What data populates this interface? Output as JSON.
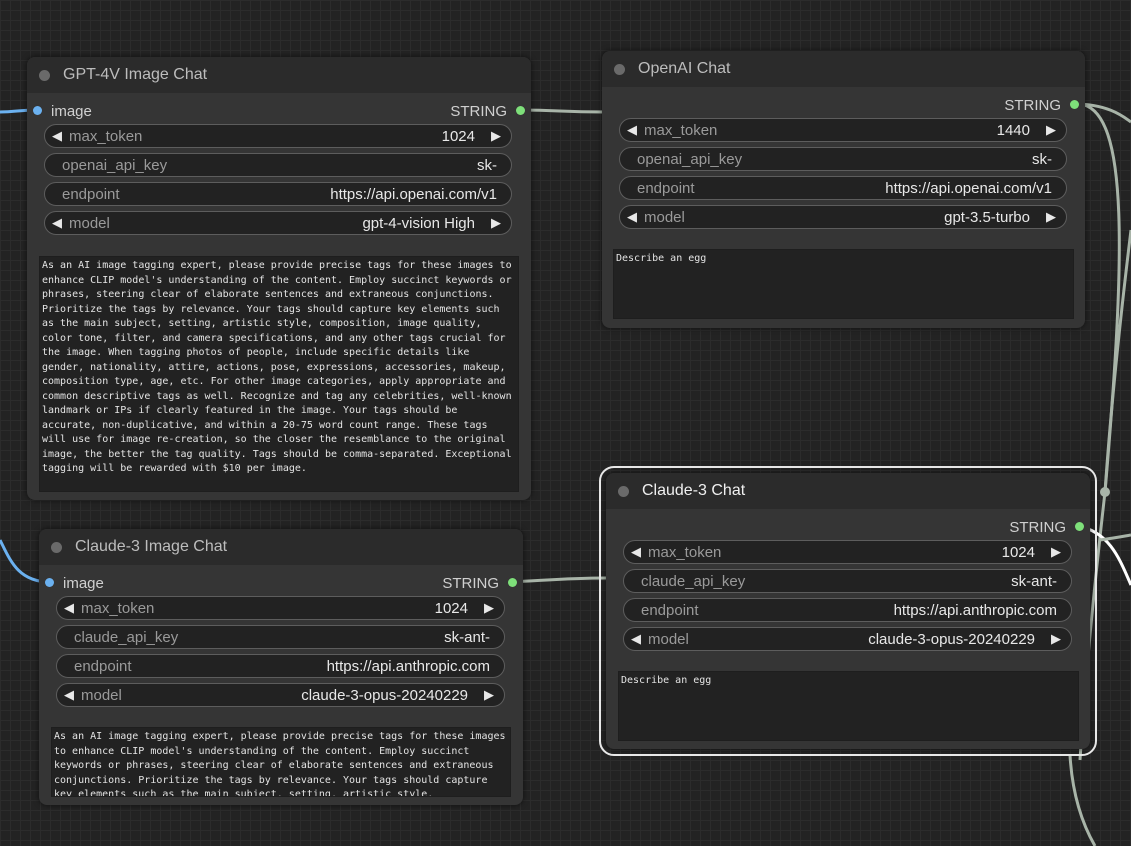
{
  "nodes": {
    "gpt4v": {
      "title": "GPT-4V Image Chat",
      "input_label": "image",
      "output_label": "STRING",
      "max_token_label": "max_token",
      "max_token_value": "1024",
      "api_key_label": "openai_api_key",
      "api_key_value": "sk-",
      "endpoint_label": "endpoint",
      "endpoint_value": "https://api.openai.com/v1",
      "model_label": "model",
      "model_value": "gpt-4-vision High",
      "prompt": "As an AI image tagging expert, please provide precise tags for these images to enhance CLIP model's understanding of the content. Employ succinct keywords or phrases, steering clear of elaborate sentences and extraneous conjunctions. Prioritize the tags by relevance. Your tags should capture key elements such as the main subject, setting, artistic style, composition, image quality, color tone, filter, and camera specifications, and any other tags crucial for the image. When tagging photos of people, include specific details like gender, nationality, attire, actions, pose, expressions, accessories, makeup, composition type, age, etc. For other image categories, apply appropriate and common descriptive tags as well. Recognize and tag any celebrities, well-known landmark or IPs if clearly featured in the image. Your tags should be accurate, non-duplicative, and within a 20-75 word count range. These tags will use for image re-creation, so the closer the resemblance to the original image, the better the tag quality. Tags should be comma-separated. Exceptional tagging will be rewarded with $10 per image."
    },
    "openai": {
      "title": "OpenAI Chat",
      "output_label": "STRING",
      "max_token_label": "max_token",
      "max_token_value": "1440",
      "api_key_label": "openai_api_key",
      "api_key_value": "sk-",
      "endpoint_label": "endpoint",
      "endpoint_value": "https://api.openai.com/v1",
      "model_label": "model",
      "model_value": "gpt-3.5-turbo",
      "prompt": "Describe an egg"
    },
    "claude3_image": {
      "title": "Claude-3 Image Chat",
      "input_label": "image",
      "output_label": "STRING",
      "max_token_label": "max_token",
      "max_token_value": "1024",
      "api_key_label": "claude_api_key",
      "api_key_value": "sk-ant-",
      "endpoint_label": "endpoint",
      "endpoint_value": "https://api.anthropic.com",
      "model_label": "model",
      "model_value": "claude-3-opus-20240229",
      "prompt": "As an AI image tagging expert, please provide precise tags for these images to enhance CLIP model's understanding of the content. Employ succinct keywords or phrases, steering clear of elaborate sentences and extraneous conjunctions. Prioritize the tags by relevance. Your tags should capture key elements such as the main subject, setting, artistic style,"
    },
    "claude3": {
      "title": "Claude-3 Chat",
      "output_label": "STRING",
      "max_token_label": "max_token",
      "max_token_value": "1024",
      "api_key_label": "claude_api_key",
      "api_key_value": "sk-ant-",
      "endpoint_label": "endpoint",
      "endpoint_value": "https://api.anthropic.com",
      "model_label": "model",
      "model_value": "claude-3-opus-20240229",
      "prompt": "Describe an egg"
    }
  },
  "colors": {
    "canvas_bg": "#232323",
    "node_bg": "#353535",
    "title_bg": "#2b2b2b",
    "image_socket": "#6bb1f0",
    "string_socket": "#7ee07a",
    "link_image": "#6bb1f0",
    "link_string": "#a8b4a8",
    "selected_outline": "#e8e8e8"
  },
  "icons": {
    "decrement": "left-triangle-icon",
    "increment": "right-triangle-icon",
    "collapse": "node-collapse-dot-icon"
  }
}
